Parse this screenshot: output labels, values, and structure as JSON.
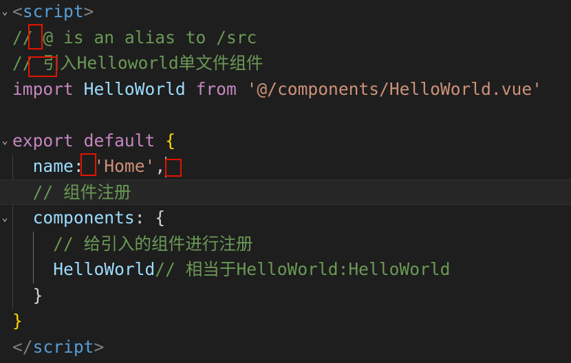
{
  "editor": {
    "lines": [
      {
        "tokens": [
          {
            "text": "<",
            "kind": "punct"
          },
          {
            "text": "script",
            "kind": "tag"
          },
          {
            "text": ">",
            "kind": "punct"
          }
        ]
      },
      {
        "tokens": [
          {
            "text": "// @ is an alias to /src",
            "kind": "comment"
          }
        ]
      },
      {
        "tokens": [
          {
            "text": "// 引入Helloworld单文件组件",
            "kind": "comment"
          }
        ]
      },
      {
        "tokens": [
          {
            "text": "import",
            "kind": "keyword"
          },
          {
            "text": " HelloWorld ",
            "kind": "var"
          },
          {
            "text": "from",
            "kind": "keyword"
          },
          {
            "text": " '@/components/HelloWorld.vue'",
            "kind": "string"
          }
        ]
      },
      {
        "tokens": []
      },
      {
        "tokens": [
          {
            "text": "export",
            "kind": "keyword"
          },
          {
            "text": " default ",
            "kind": "keyword"
          },
          {
            "text": "{",
            "kind": "brace"
          }
        ]
      },
      {
        "tokens": [
          {
            "text": "  name",
            "kind": "var"
          },
          {
            "text": ": ",
            "kind": "plain"
          },
          {
            "text": "'Home'",
            "kind": "string"
          },
          {
            "text": ",",
            "kind": "plain"
          }
        ]
      },
      {
        "tokens": [
          {
            "text": "  // 组件注册",
            "kind": "comment"
          }
        ]
      },
      {
        "tokens": [
          {
            "text": "  components",
            "kind": "var"
          },
          {
            "text": ": {",
            "kind": "plain"
          }
        ]
      },
      {
        "tokens": [
          {
            "text": "    // 给引入的组件进行注册",
            "kind": "comment"
          }
        ]
      },
      {
        "tokens": [
          {
            "text": "    HelloWorld",
            "kind": "var"
          },
          {
            "text": "// 相当于HelloWorld:HelloWorld",
            "kind": "comment"
          }
        ]
      },
      {
        "tokens": [
          {
            "text": "  }",
            "kind": "plain"
          }
        ]
      },
      {
        "tokens": [
          {
            "text": "}",
            "kind": "brace"
          }
        ]
      },
      {
        "tokens": [
          {
            "text": "</",
            "kind": "punct"
          },
          {
            "text": "script",
            "kind": "tag"
          },
          {
            "text": ">",
            "kind": "punct"
          }
        ]
      }
    ],
    "fold_icon": "chevron-down-icon",
    "fold_glyph": "⌄",
    "current_line": 8,
    "colors": {
      "background": "#1e1e1e",
      "comment": "#6a9955",
      "keyword": "#c586c0",
      "variable": "#9cdcfe",
      "string": "#ce9178",
      "tag": "#569cd6",
      "punctuation": "#808080",
      "brace": "#ffd700",
      "annotation_box": "#e51400"
    }
  }
}
